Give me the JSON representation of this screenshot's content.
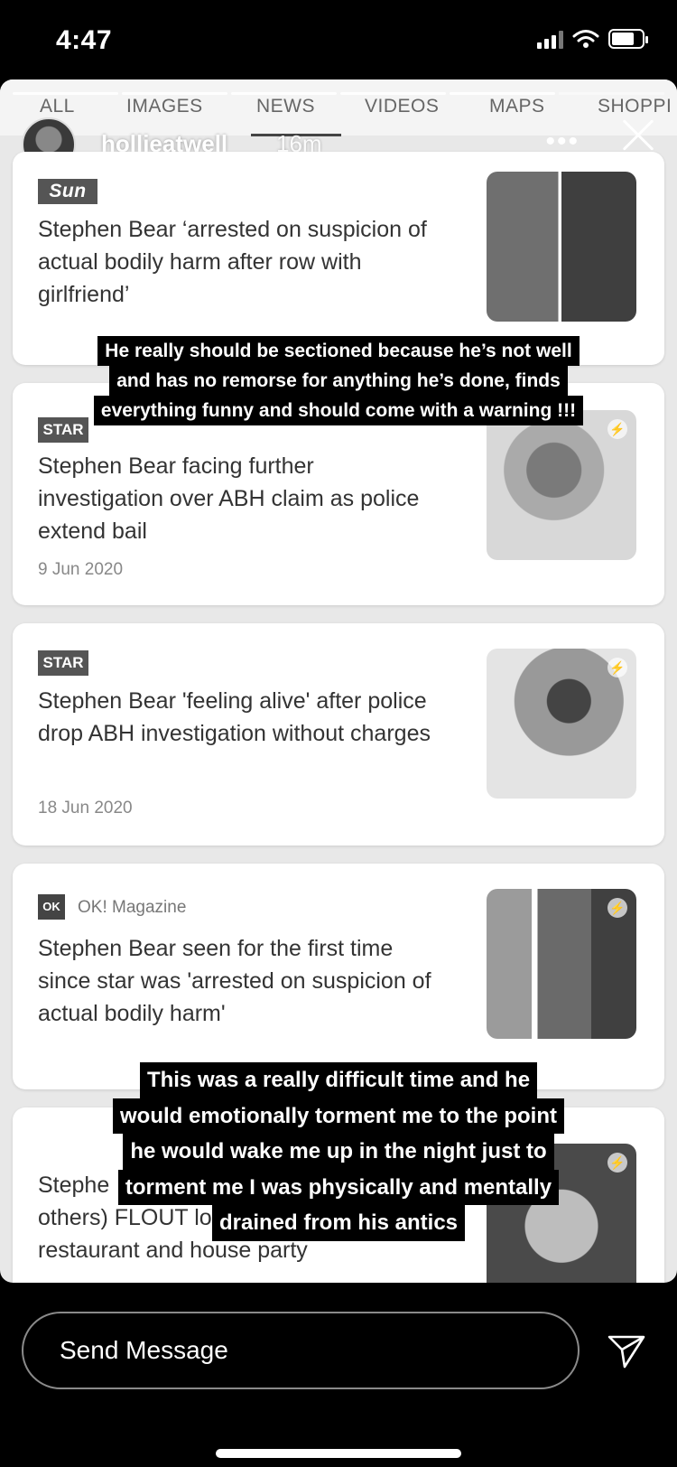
{
  "status_bar": {
    "time": "4:47"
  },
  "search_tabs": [
    "ALL",
    "IMAGES",
    "NEWS",
    "VIDEOS",
    "MAPS",
    "SHOPPI"
  ],
  "story": {
    "username": "hollieatwell",
    "time_ago": "16m"
  },
  "cards": [
    {
      "source_logo": "Sun",
      "headline": "Stephen Bear ‘arrested on suspicion of actual bodily harm after row with girlfriend’"
    },
    {
      "source_logo": "STAR",
      "headline": "Stephen Bear facing further investigation over ABH claim as police extend bail",
      "date": "9 Jun 2020"
    },
    {
      "source_logo": "STAR",
      "headline": "Stephen Bear 'feeling alive' after police drop ABH investigation without charges",
      "date": "18 Jun 2020"
    },
    {
      "source_logo": "OK",
      "source_name": "OK! Magazine",
      "headline": "Stephen Bear seen for the first time since star was 'arrested on suspicion of actual bodily harm'"
    },
    {
      "headline_lines": [
        "Stephe",
        "others) FLOUT lockdown rules at",
        "restaurant and house party"
      ]
    }
  ],
  "captions": {
    "top": [
      "He really should be sectioned because he’s not well",
      "and has no remorse for anything he’s done, finds",
      "everything funny and should come with a warning !!!"
    ],
    "bottom": [
      "This was a really difficult time and he",
      "would emotionally torment me to the point",
      "he would wake me up in the night just to",
      "torment me I was physically and mentally",
      "drained from his antics"
    ]
  },
  "reply": {
    "placeholder": "Send Message"
  },
  "icons": {
    "more": "more-options-icon",
    "close": "close-icon",
    "send": "send-icon",
    "bolt": "amp-bolt-icon"
  }
}
